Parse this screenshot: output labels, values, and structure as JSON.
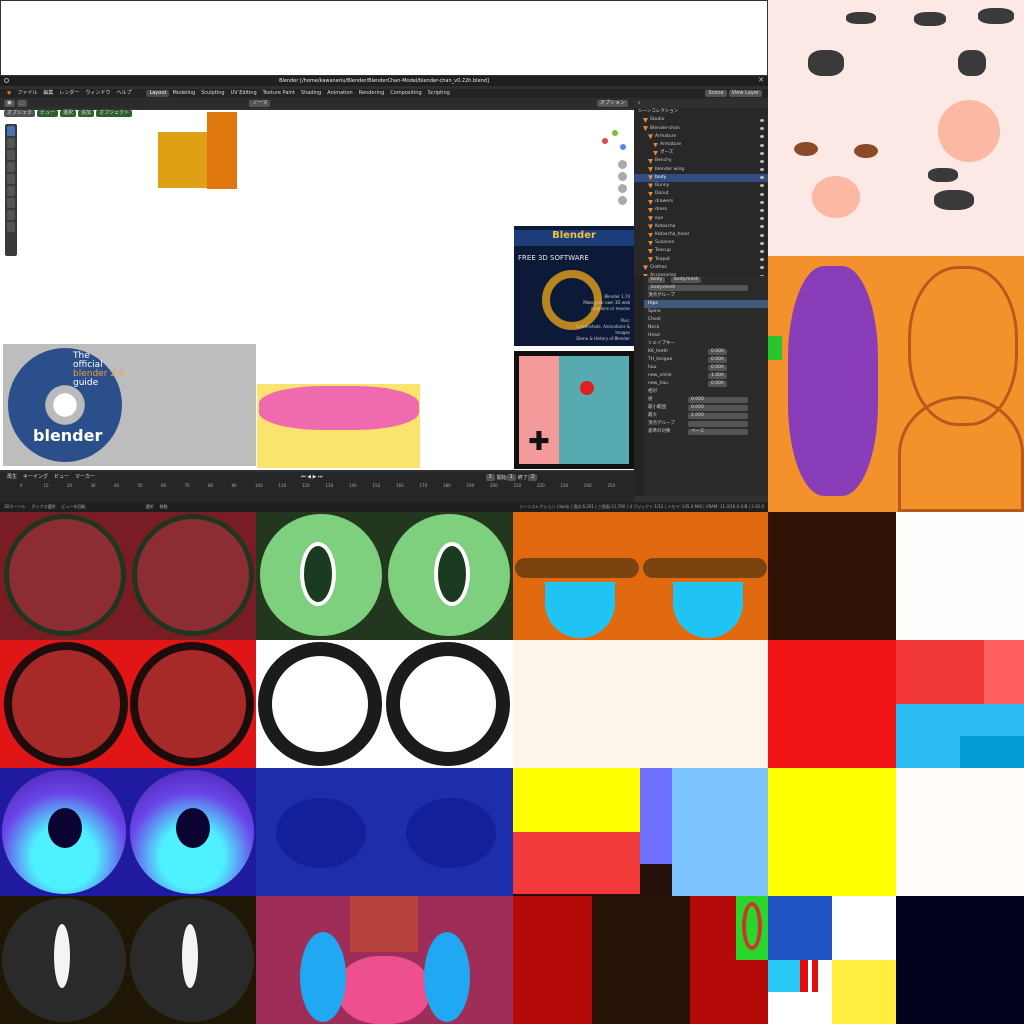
{
  "blender": {
    "title": "Blender [/home/kawaneriu/Blender/BlenderChan-Model/blender-chan_v0.22h.blend]",
    "menu": [
      "ファイル",
      "編集",
      "レンダー",
      "ウィンドウ",
      "ヘルプ"
    ],
    "workspaces": [
      "Layout",
      "Modeling",
      "Sculpting",
      "UV Editing",
      "Texture Paint",
      "Shading",
      "Animation",
      "Rendering",
      "Compositing",
      "Scripting"
    ],
    "active_workspace": "Layout",
    "header_mode": "ノーマ",
    "scene": "Scene",
    "view_layer": "View Layer",
    "options": "オプション",
    "viewport_mode": "オブジェク",
    "viewport_menus": [
      "ビュー",
      "選択",
      "追加",
      "オブジェクト"
    ],
    "outliner": {
      "title": "シーンコレクション",
      "rows": [
        "Studio",
        "Blender-chan",
        "Armature",
        "Armature",
        "ポーズ",
        "Benchy",
        "blender wing",
        "body",
        "Bunny",
        "Donut",
        "drawers",
        "dress",
        "eye",
        "Kotoscha",
        "Kotoscha_head",
        "Suzanne",
        "Teacup",
        "Teapot",
        "Clothes",
        "Accessories"
      ],
      "selected": "body"
    },
    "properties": {
      "object": "body",
      "mesh": "body.mesh",
      "data_name": "body.mesh",
      "vgroups_title": "頂点グループ",
      "vgroups": [
        "Hips",
        "Spine",
        "Chest",
        "Neck",
        "Head"
      ],
      "shapekeys_title": "シェイプキー",
      "shapekeys": [
        {
          "name": "KK_teeth",
          "value": "0.000"
        },
        {
          "name": "TH_tongue",
          "value": "0.000"
        },
        {
          "name": "hau",
          "value": "0.000"
        },
        {
          "name": "new_smile",
          "value": "1.000"
        },
        {
          "name": "new_hau",
          "value": "0.000"
        }
      ],
      "relative": "相対",
      "value_label": "値",
      "value": "0.000",
      "min_label": "最小範囲",
      "min": "0.000",
      "max_label": "最大",
      "max": "1.000",
      "vgroup_label": "頂点グループ",
      "basis_label": "基準の対象",
      "basis": "ベース"
    },
    "timeline": {
      "menus": [
        "再生",
        "キーイング",
        "ビュー",
        "マーカー"
      ],
      "current_frame": "1",
      "start_label": "開始",
      "start": "1",
      "end_label": "終了",
      "end": "2",
      "frame_value": "3",
      "ticks": [
        "0",
        "10",
        "20",
        "30",
        "40",
        "50",
        "60",
        "70",
        "80",
        "90",
        "100",
        "110",
        "120",
        "130",
        "140",
        "150",
        "160",
        "170",
        "180",
        "190",
        "200",
        "210",
        "220",
        "230",
        "240",
        "250"
      ]
    },
    "status_left": [
      "3Dカーソル",
      "ボックス選択",
      "ビューを回転",
      "選択",
      "移動"
    ],
    "status_right": "シーンコレクション | body | 頂点:6,301 | 三角面:11,760 | オブジェクト:1/12 | メモリ: 145.0 MiB | VRAM: 11.0/16.0 GiB | 2.92.0"
  },
  "splash": {
    "brand": "Blender",
    "heading": "FREE 3D SOFTWARE",
    "lines": [
      "Blender 1.74",
      "Make your own 3D web",
      "creations or movies",
      "",
      "Plus:",
      "Screenshots, Animations & Images",
      "Demo & History of Blender"
    ]
  },
  "cd": {
    "line1": "The",
    "line2": "official",
    "line3": "blender 2.0",
    "line4": "guide",
    "brand": "blender"
  },
  "colors": {
    "blender_bg": "#303030",
    "select_blue": "#334d80",
    "accent_orange": "#e6893a"
  }
}
